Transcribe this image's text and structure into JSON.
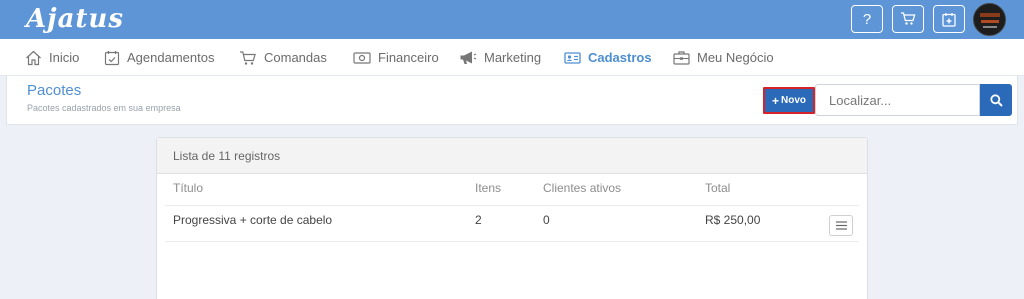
{
  "app": {
    "logo": "Ajatus"
  },
  "topbar": {
    "help_label": "?",
    "icons": [
      "help-icon",
      "cart-icon",
      "calendar-plus-icon"
    ],
    "avatar": "user-avatar"
  },
  "nav": {
    "items": [
      {
        "label": "Inicio",
        "icon": "home-icon"
      },
      {
        "label": "Agendamentos",
        "icon": "calendar-check-icon"
      },
      {
        "label": "Comandas",
        "icon": "cart-icon"
      },
      {
        "label": "Financeiro",
        "icon": "money-icon"
      },
      {
        "label": "Marketing",
        "icon": "megaphone-icon"
      },
      {
        "label": "Cadastros",
        "icon": "id-card-icon",
        "active": true
      },
      {
        "label": "Meu Negócio",
        "icon": "briefcase-icon"
      }
    ]
  },
  "page": {
    "title": "Pacotes",
    "subtitle": "Pacotes cadastrados em sua empresa",
    "new_button": "Novo",
    "search_placeholder": "Localizar..."
  },
  "list": {
    "header": "Lista de 11 registros",
    "columns": [
      "Título",
      "Itens",
      "Clientes ativos",
      "Total"
    ],
    "rows": [
      {
        "title": "Progressiva + corte de cabelo",
        "items": "2",
        "active_clients": "0",
        "total": "R$ 250,00"
      }
    ]
  },
  "colors": {
    "topbar": "#5d95d7",
    "accent": "#4f8fd3",
    "primary_button": "#2a6ab8",
    "highlight_border": "#d6232a",
    "background": "#edf0f6"
  }
}
